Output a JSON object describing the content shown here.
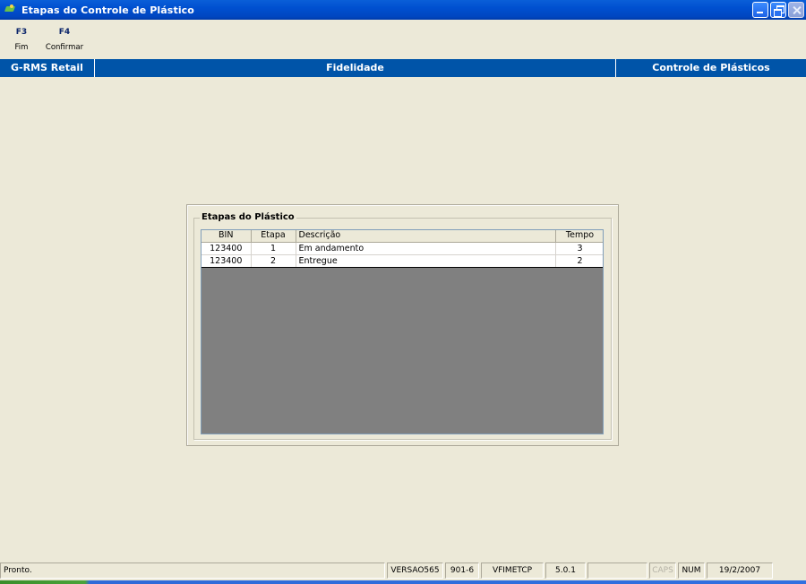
{
  "window": {
    "title": "Etapas do Controle de Plástico"
  },
  "toolbar": {
    "f3": {
      "key": "F3",
      "label": "Fim"
    },
    "f4": {
      "key": "F4",
      "label": "Confirmar"
    }
  },
  "header": {
    "left": "G-RMS Retail",
    "center": "Fidelidade",
    "right": "Controle de Plásticos"
  },
  "panel": {
    "group_title": "Etapas do Plástico",
    "columns": [
      "BIN",
      "Etapa",
      "Descrição",
      "Tempo"
    ],
    "rows": [
      [
        "123400",
        "1",
        "Em andamento",
        "3"
      ],
      [
        "123400",
        "2",
        "Entregue",
        "2"
      ]
    ]
  },
  "status": {
    "message": "Pronto.",
    "version": "VERSAO565",
    "code": "901-6",
    "program": "VFIMETCP",
    "release": "5.0.1",
    "empty": "",
    "caps": "CAPS",
    "num": "NUM",
    "date": "19/2/2007"
  },
  "colors": {
    "titlebar": "#0050d0",
    "header": "#0054a8",
    "background": "#ece9d8",
    "grid_empty": "#808080"
  }
}
